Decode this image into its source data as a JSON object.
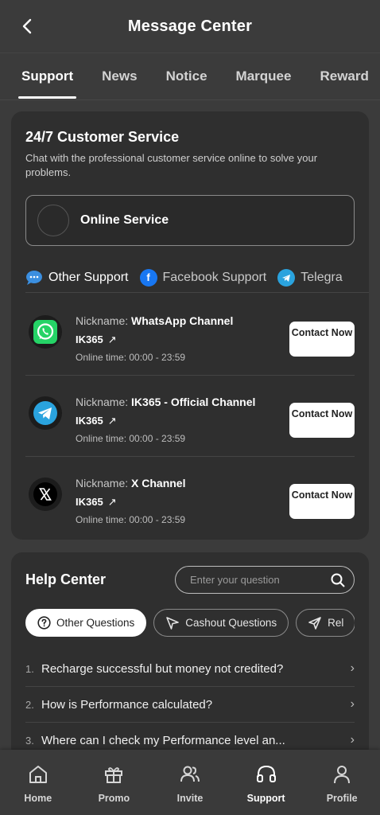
{
  "header": {
    "title": "Message Center"
  },
  "tabs": [
    "Support",
    "News",
    "Notice",
    "Marquee",
    "Reward"
  ],
  "customer_service": {
    "title": "24/7 Customer Service",
    "subtitle": "Chat with the professional customer service online to solve your problems.",
    "online_label": "Online Service"
  },
  "support_tabs": [
    "Other Support",
    "Facebook Support",
    "Telegra"
  ],
  "channels": [
    {
      "nick_label": "Nickname:",
      "name": "WhatsApp Channel",
      "account": "IK365",
      "time": "Online time: 00:00 - 23:59",
      "button": "Contact Now"
    },
    {
      "nick_label": "Nickname:",
      "name": "IK365 - Official Channel",
      "account": "IK365",
      "time": "Online time: 00:00 - 23:59",
      "button": "Contact Now"
    },
    {
      "nick_label": "Nickname:",
      "name": "X Channel",
      "account": "IK365",
      "time": "Online time: 00:00 - 23:59",
      "button": "Contact Now"
    }
  ],
  "help": {
    "title": "Help Center",
    "search_placeholder": "Enter your question",
    "tabs": [
      "Other Questions",
      "Cashout Questions",
      "Rel"
    ],
    "faqs": [
      {
        "n": "1.",
        "text": "Recharge successful but money not credited?"
      },
      {
        "n": "2.",
        "text": "How is Performance calculated?"
      },
      {
        "n": "3.",
        "text": "Where can I check my Performance level an..."
      }
    ]
  },
  "bottom_nav": [
    "Home",
    "Promo",
    "Invite",
    "Support",
    "Profile"
  ],
  "colors": {
    "whatsapp": "#25d366",
    "telegram": "#2aa3de",
    "facebook": "#1877f2"
  }
}
